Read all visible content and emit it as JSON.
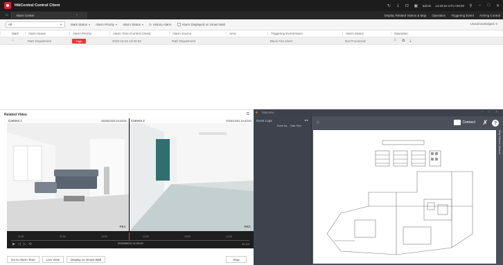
{
  "window": {
    "title": "HikCentral Control Client",
    "module_tab": "Alarm Center",
    "user": "admin",
    "datetime": "14:25:52 UTC+08:00"
  },
  "topnav": {
    "items": [
      "Display Related Videos & Map",
      "Operation",
      "Triggering Event",
      "Arming Control"
    ]
  },
  "filters": {
    "all_select": "All",
    "mark_status": "Mark Status",
    "alarm_priority": "Alarm Priority",
    "alarm_status": "Alarm Status",
    "history_alarm": "History Alarm",
    "smart_wall": "Alarm Displayed on Smart Wall",
    "unacknowledged": "Unacknowledged: 0"
  },
  "table": {
    "columns": [
      "Mark",
      "Alarm Name",
      "Alarm Priority",
      "Alarm Time (Control Client)",
      "Alarm Source",
      "Area",
      "Triggering Event/Alarm",
      "Alarm Status",
      "Operation"
    ],
    "rows": [
      {
        "mark": "☆",
        "name": "R&D Department",
        "priority": "High",
        "time": "2020-10-02 10:40:53",
        "source": "R&D Department",
        "area": "",
        "event": "Black Fire Alarm",
        "status": "Not Processed"
      }
    ]
  },
  "related_video": {
    "title": "Related Video",
    "cameras": [
      {
        "label": "Camera 1",
        "time": "05/28/2020 10:43:51",
        "rec": "REC"
      },
      {
        "label": "Camera 2",
        "time": "2020/12/01 10:43:51",
        "rec": "REC"
      }
    ],
    "timeline": {
      "ticks": [
        "11:00",
        "11:30",
        "12:00",
        "12:30",
        "13:00",
        "13:30"
      ],
      "current": "2020/08/19 14:25:40",
      "zoom": "1x",
      "span": "1m"
    },
    "buttons": {
      "go_to_alarm": "Go to Alarm Time",
      "live_view": "Live View",
      "smart_wall": "Display on Smart Wall",
      "stop": "Stop"
    }
  },
  "map": {
    "panel_label": "Mapview",
    "event_logs": "Event Logs",
    "event_cols": [
      "Event Sq...",
      "Date Time"
    ],
    "connect": "Connect",
    "side_label": "Map Device Search"
  }
}
